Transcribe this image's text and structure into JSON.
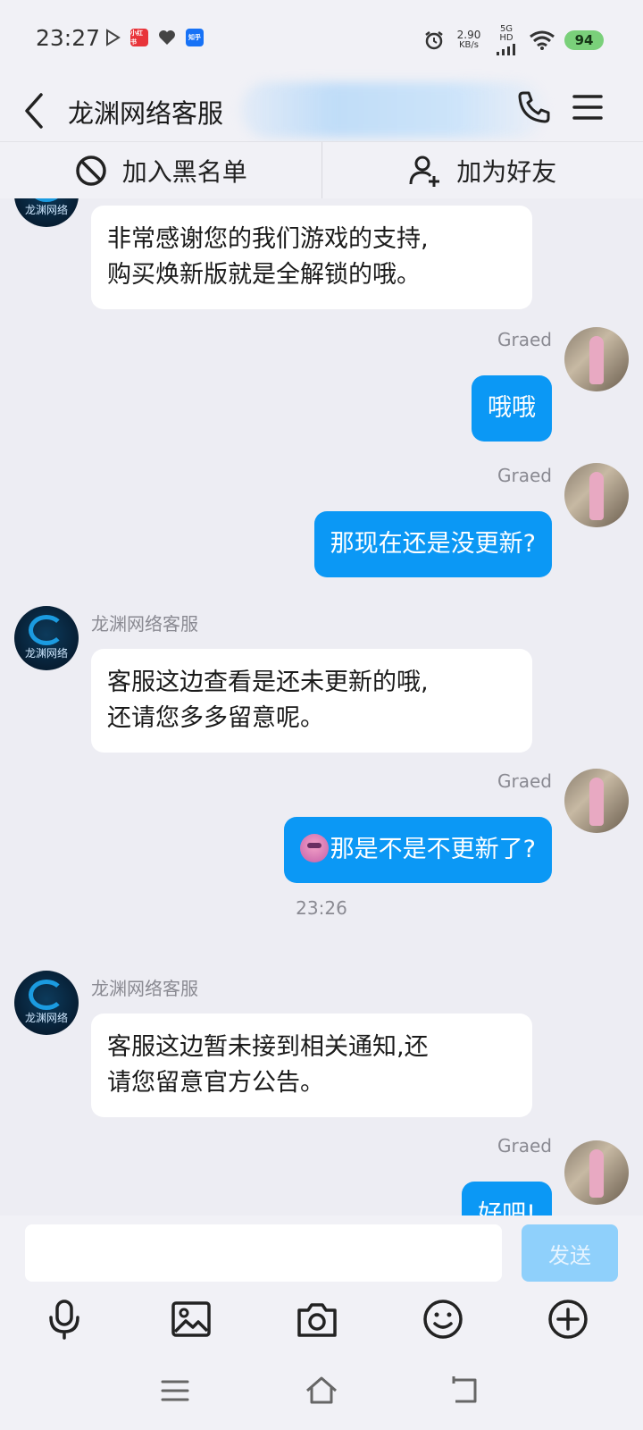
{
  "status_bar": {
    "time": "23:27",
    "net_speed_value": "2.90",
    "net_speed_unit": "KB/s",
    "net_type": "5G HD",
    "battery": "94",
    "app_badges": [
      "小红书",
      "知乎"
    ]
  },
  "header": {
    "title": "龙渊网络客服"
  },
  "actions": {
    "blacklist": "加入黑名单",
    "add_friend": "加为好友"
  },
  "messages": [
    {
      "side": "left",
      "sender": "",
      "text_lines": [
        "非常感谢您的我们游戏的支持,",
        "购买焕新版就是全解锁的哦。"
      ]
    },
    {
      "side": "right",
      "sender": "Graed",
      "text": "哦哦"
    },
    {
      "side": "right",
      "sender": "Graed",
      "text": "那现在还是没更新?"
    },
    {
      "side": "left",
      "sender": "龙渊网络客服",
      "text_lines": [
        "客服这边查看是还未更新的哦,",
        "还请您多多留意呢。"
      ]
    },
    {
      "side": "right",
      "sender": "Graed",
      "text": "那是不是不更新了?",
      "emoji": "pink-face-emoji"
    },
    {
      "side": "left",
      "sender": "龙渊网络客服",
      "text_lines": [
        "客服这边暂未接到相关通知,还",
        "请您留意官方公告。"
      ]
    },
    {
      "side": "right",
      "sender": "Graed",
      "text": "好吧!"
    }
  ],
  "timestamp": "23:26",
  "avatar_logo_text": "龙渊网络",
  "composer": {
    "value": "",
    "send_label": "发送"
  },
  "icons": {
    "tools": [
      "microphone-icon",
      "image-icon",
      "camera-icon",
      "emoji-icon",
      "plus-icon"
    ],
    "nav": [
      "menu-icon",
      "home-icon",
      "back-icon"
    ]
  },
  "colors": {
    "accent_bubble": "#0b98f5",
    "send_button": "#8fd0fb",
    "background": "#ededf3"
  }
}
